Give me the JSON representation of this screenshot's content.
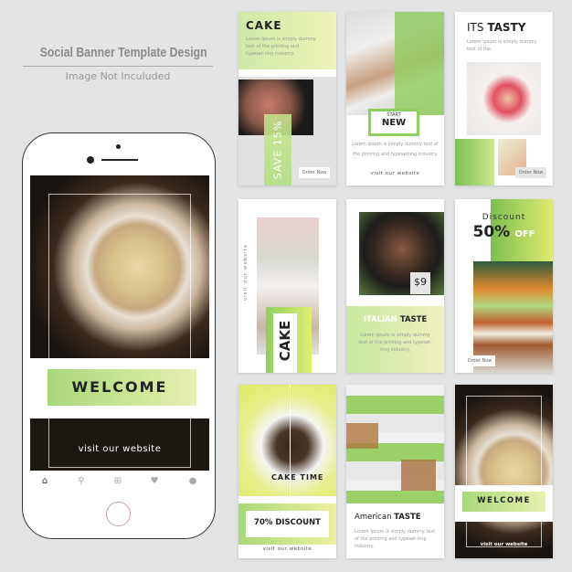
{
  "header": {
    "title": "Social Banner Template Design",
    "subtitle": "Image Not Inculuded"
  },
  "phone": {
    "welcome": "WELCOME",
    "link": "visit our website",
    "nav_icons": [
      "home-icon",
      "search-icon",
      "plus-square-icon",
      "heart-icon",
      "user-icon"
    ]
  },
  "cards": {
    "c1": {
      "title": "CAKE",
      "lorem": "Lorem Ipsum is simply dummy text of the printing and typeset-ting industry.",
      "save": "SAVE 15%",
      "button": "Order Now"
    },
    "c2": {
      "kicker": "START",
      "title": "NEW",
      "lorem": "Lorem Ipsum is simply dummy text of the printing and typesetting industry.",
      "link": "visit our website"
    },
    "c3": {
      "title_light": "ITS",
      "title_bold": "TASTY",
      "lorem": "Lorem ipsum is simply dummy text of the.",
      "button": "Order Now"
    },
    "c4": {
      "side": "visit our website",
      "title": "CAKE"
    },
    "c5": {
      "price": "$9",
      "title_light": "ITALIAN",
      "title_bold": "TASTE",
      "lorem": "Lorem Ipsum is simply dummy text of the printing and typeset-ting industry."
    },
    "c6": {
      "kicker": "Discount",
      "big": "50%",
      "off": "OFF",
      "button": "Order Now"
    },
    "c7": {
      "title": "CAKE TIME",
      "discount": "70% DISCOUNT",
      "link": "visit our website"
    },
    "c8": {
      "title_light": "American",
      "title_bold": "TASTE",
      "lorem": "Lorem Ipsum is simply dummy text of the printing and typeset-ting industry."
    },
    "c9": {
      "welcome": "WELCOME",
      "link": "visit our website"
    }
  },
  "colors": {
    "accent_green": "#8fcf5f",
    "accent_yellow": "#e8ef9a",
    "background": "#e3e4e5"
  }
}
